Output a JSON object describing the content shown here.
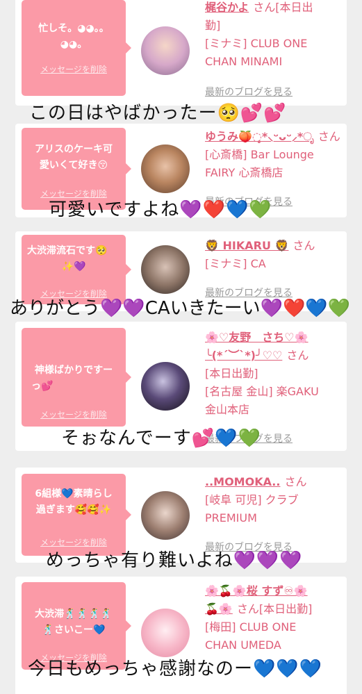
{
  "delete_label": "メッセージを削除",
  "blog_label": "最新のブログを見る",
  "honorific": "さん",
  "cards": [
    {
      "bubble": [
        "忙しそ。◕◕。。",
        "◕◕。"
      ],
      "name": "梶谷かよ",
      "suffix": "[本日出",
      "info": [
        "勤]",
        "[ミナミ] CLUB ONE",
        "CHAN MINAMI"
      ]
    },
    {
      "bubble": [
        "アリスのケーキ可",
        "愛いくて好き😚"
      ],
      "name": "ゆうみ🍑◌̥̥̥̥*⸜ᵕᴗᵕ⸝*ೃ",
      "suffix": "",
      "info": [
        "[心斎橋] Bar Lounge",
        "FAIRY 心斎橋店"
      ]
    },
    {
      "bubble": [
        "大渋滞流石です🥺",
        "✨💜"
      ],
      "name": "🦁 HIKARU 🦁",
      "suffix": "",
      "info": [
        "[ミナミ] CA"
      ]
    },
    {
      "bubble": [
        "神様ばかりですー",
        "っ💕"
      ],
      "name": "🌸♡友野　さち♡🌸",
      "name2": "╰(*´︶`*)╯♡♡",
      "suffix": "",
      "info": [
        "[本日出勤]",
        "[名古屋 金山] 楽GAKU",
        "金山本店"
      ]
    },
    {
      "bubble": [
        "6組様💙素晴らし",
        "過ぎます🥰🥰✨"
      ],
      "name": "..MOMOKA..",
      "suffix": "",
      "info": [
        "[岐阜 可児] クラブ",
        "PREMIUM"
      ]
    },
    {
      "bubble": [
        "大渋滞🕺🕺🕺🕺",
        "🕺さいこー💙"
      ],
      "name": "🌸🍒🌸桜 すず♾🌸",
      "name2": "🍒🌸",
      "suffix": "[本日出勤]",
      "info": [
        "[梅田] CLUB ONE",
        "CHAN UMEDA"
      ]
    }
  ],
  "overlays": [
    "この日はやばかったー🥺💕💕",
    "可愛いですよね💜❤️💙💚",
    "ありがとう💜💜CAいきたーい💜❤️💙💚",
    "そぉなんでーす💕💙💚",
    "めっちゃ有り難いよね💜💜💜",
    "今日もめっちゃ感謝なのー💙💙💙"
  ],
  "colors": {
    "bubble": "#fb9aa7",
    "accent": "#e0607a",
    "background": "#eeeeee"
  }
}
